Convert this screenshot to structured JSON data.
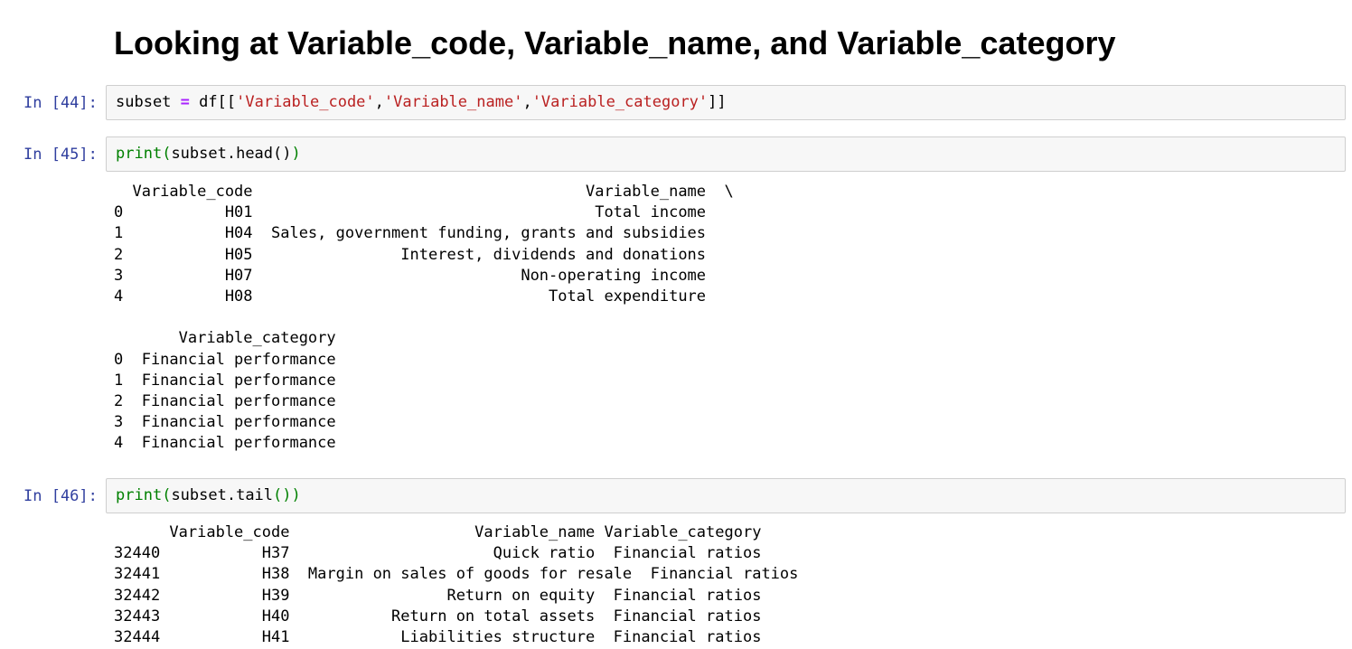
{
  "heading": "Looking at Variable_code, Variable_name, and Variable_category",
  "cells": [
    {
      "prompt": "In [44]:",
      "code": {
        "var": "subset",
        "op": "=",
        "df": "df[[",
        "s1": "'Variable_code'",
        "comma1": ",",
        "s2": "'Variable_name'",
        "comma2": ",",
        "s3": "'Variable_category'",
        "close": "]]"
      }
    },
    {
      "prompt": "In [45]:",
      "code": {
        "fn": "print",
        "open": "(",
        "arg": "subset.head()",
        "close": ")"
      },
      "output": [
        "  Variable_code                                    Variable_name  \\",
        "0           H01                                     Total income   ",
        "1           H04  Sales, government funding, grants and subsidies   ",
        "2           H05                Interest, dividends and donations   ",
        "3           H07                             Non-operating income   ",
        "4           H08                                Total expenditure   ",
        "",
        "       Variable_category  ",
        "0  Financial performance  ",
        "1  Financial performance  ",
        "2  Financial performance  ",
        "3  Financial performance  ",
        "4  Financial performance  "
      ]
    },
    {
      "prompt": "In [46]:",
      "code": {
        "fn": "print",
        "open": "(",
        "arg1": "subset.tail",
        "arg2": "()",
        "close": ")"
      },
      "output": [
        "      Variable_code                    Variable_name Variable_category",
        "32440           H37                      Quick ratio  Financial ratios",
        "32441           H38  Margin on sales of goods for resale  Financial ratios",
        "32442           H39                 Return on equity  Financial ratios",
        "32443           H40           Return on total assets  Financial ratios",
        "32444           H41            Liabilities structure  Financial ratios"
      ]
    }
  ]
}
